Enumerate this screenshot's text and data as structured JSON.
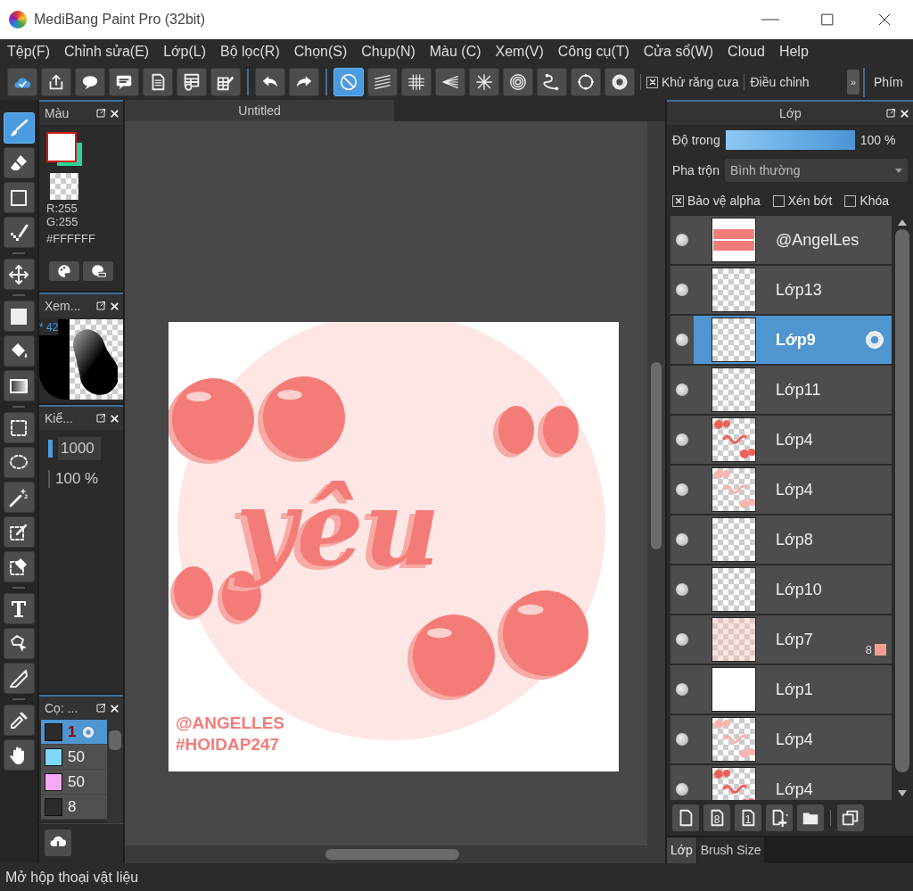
{
  "window": {
    "title": "MediBang Paint Pro (32bit)"
  },
  "menu": [
    "Tệp(F)",
    "Chỉnh sửa(E)",
    "Lớp(L)",
    "Bộ lọc(R)",
    "Chọn(S)",
    "Chụp(N)",
    "Màu (C)",
    "Xem(V)",
    "Công cụ(T)",
    "Cửa sổ(W)",
    "Cloud",
    "Help"
  ],
  "toolbar": {
    "groups": [
      [
        {
          "kind": "cloud",
          "selected": false
        },
        {
          "kind": "upload",
          "selected": false
        },
        {
          "kind": "speech",
          "selected": false
        },
        {
          "kind": "comment",
          "selected": false
        },
        {
          "kind": "doc",
          "selected": false
        },
        {
          "kind": "tableclock",
          "selected": false
        },
        {
          "kind": "gridedit",
          "selected": false
        }
      ],
      [
        {
          "kind": "undo",
          "selected": false
        },
        {
          "kind": "redo",
          "selected": false
        }
      ],
      [
        {
          "kind": "nosnap",
          "selected": true
        },
        {
          "kind": "parallel",
          "selected": false
        },
        {
          "kind": "grid",
          "selected": false
        },
        {
          "kind": "vanish",
          "selected": false
        },
        {
          "kind": "burst",
          "selected": false
        },
        {
          "kind": "concentric",
          "selected": false
        },
        {
          "kind": "curve",
          "selected": false
        },
        {
          "kind": "circle",
          "selected": false
        },
        {
          "kind": "gear",
          "selected": false
        }
      ]
    ],
    "antialias": {
      "label": "Khử răng cưa",
      "checked": true
    },
    "adjust": "Điều chỉnh",
    "more": "»",
    "side_tab": "Phím"
  },
  "tools": [
    [
      {
        "kind": "brush",
        "selected": true
      },
      {
        "kind": "eraser",
        "selected": false
      },
      {
        "kind": "rect",
        "selected": false
      },
      {
        "kind": "dotpen",
        "selected": false
      }
    ],
    [
      {
        "kind": "move",
        "selected": false
      }
    ],
    [
      {
        "kind": "fill",
        "selected": false
      },
      {
        "kind": "bucket",
        "selected": false
      },
      {
        "kind": "gradient",
        "selected": false
      }
    ],
    [
      {
        "kind": "dashrect",
        "selected": false
      },
      {
        "kind": "lasso",
        "selected": false
      },
      {
        "kind": "wand",
        "selected": false
      },
      {
        "kind": "selpen",
        "selected": false
      },
      {
        "kind": "seleraser",
        "selected": false
      }
    ],
    [
      {
        "kind": "text",
        "selected": false
      },
      {
        "kind": "polysel",
        "selected": false
      },
      {
        "kind": "blade",
        "selected": false
      }
    ],
    [
      {
        "kind": "dropper",
        "selected": false
      },
      {
        "kind": "hand",
        "selected": false
      }
    ]
  ],
  "color_panel": {
    "title": "Màu",
    "values": [
      "R:255",
      "G:255"
    ],
    "hex": "#FFFFFF"
  },
  "navigator": {
    "title": "Xem...",
    "zoom": "* 42"
  },
  "brush_size": {
    "title": "Kiể...",
    "size": "1000",
    "opacity": "100 %"
  },
  "brushes": {
    "title": "Cọ: ...",
    "items": [
      {
        "size": "1",
        "color": "#2b2b2b",
        "selected": true
      },
      {
        "size": "50",
        "color": "#7fd8f7",
        "selected": false
      },
      {
        "size": "50",
        "color": "#f7a8f5",
        "selected": false
      },
      {
        "size": "8",
        "color": "#2b2b2b",
        "selected": false
      }
    ]
  },
  "canvas": {
    "tab": "Untitled",
    "lettering": "yêu",
    "signature": [
      "@ANGELLES",
      "#HOIDAP247"
    ]
  },
  "layers_panel": {
    "title": "Lớp",
    "opacity": {
      "label": "Độ trong",
      "level": 1,
      "reading": "100 %"
    },
    "blend": {
      "label": "Pha trộn",
      "value": "Bình thường"
    },
    "options": [
      {
        "label": "Bảo vệ alpha",
        "checked": true
      },
      {
        "label": "Xén bớt",
        "checked": false
      },
      {
        "label": "Khóa",
        "checked": false
      }
    ],
    "layers": [
      {
        "name": "@AngelLes",
        "kind": "banner",
        "selected": false
      },
      {
        "name": "Lớp13",
        "kind": "empty",
        "selected": false
      },
      {
        "name": "Lớp9",
        "kind": "empty",
        "selected": true
      },
      {
        "name": "Lớp11",
        "kind": "empty",
        "selected": false
      },
      {
        "name": "Lớp4",
        "kind": "art",
        "selected": false
      },
      {
        "name": "Lớp4",
        "kind": "faint",
        "selected": false
      },
      {
        "name": "Lớp8",
        "kind": "empty",
        "selected": false
      },
      {
        "name": "Lớp10",
        "kind": "empty",
        "selected": false
      },
      {
        "name": "Lớp7",
        "kind": "tint",
        "selected": false,
        "badge": "8",
        "color": "#f4a090"
      },
      {
        "name": "Lớp1",
        "kind": "white",
        "selected": false
      },
      {
        "name": "Lớp4",
        "kind": "faint",
        "selected": false
      },
      {
        "name": "Lớp4",
        "kind": "art",
        "selected": false
      }
    ],
    "actions": [
      {
        "kind": "new"
      },
      {
        "kind": "new-digit",
        "text": "8"
      },
      {
        "kind": "new-digit",
        "text": "1"
      },
      {
        "kind": "add"
      },
      {
        "kind": "folder"
      },
      {
        "kind": "duplicate"
      }
    ],
    "tabs": [
      {
        "label": "Lớp",
        "selected": true
      },
      {
        "label": "Brush Size",
        "selected": false
      }
    ]
  },
  "status_bar": "Mở hộp thoại vật liệu"
}
